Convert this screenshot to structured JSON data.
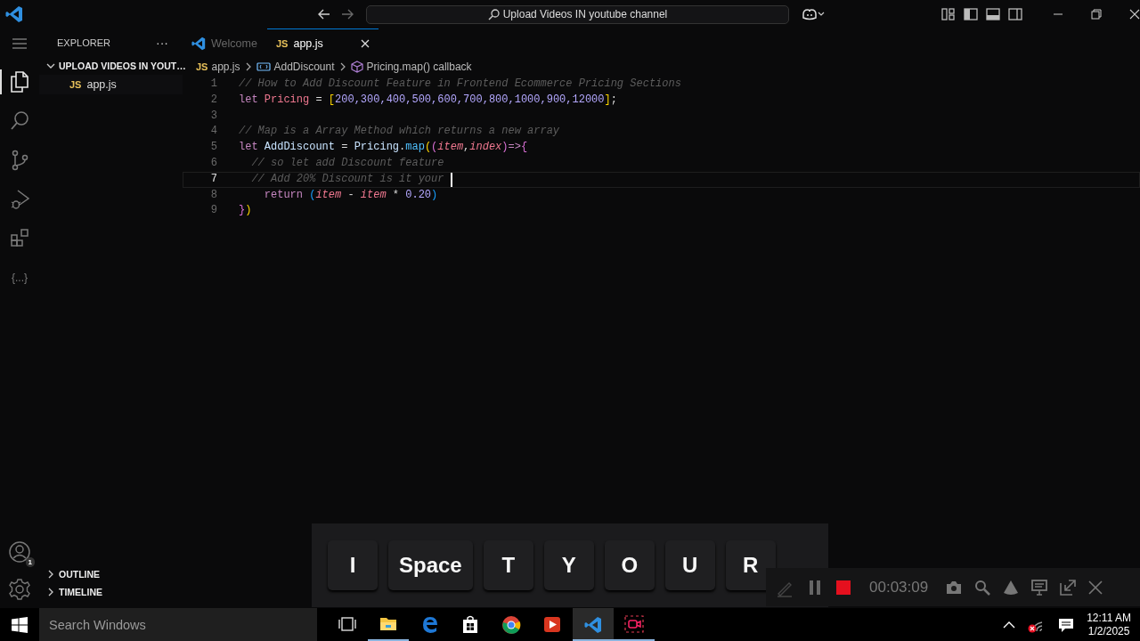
{
  "title_bar": {
    "search_text": "Upload Videos IN youtube channel"
  },
  "activity_bar": {
    "items": [
      {
        "kind": "files",
        "selected": true
      },
      {
        "kind": "search",
        "selected": false
      },
      {
        "kind": "source-control",
        "selected": false
      },
      {
        "kind": "run-debug",
        "selected": false
      },
      {
        "kind": "extensions",
        "selected": false
      },
      {
        "kind": "text",
        "label": "{...}",
        "selected": false
      }
    ],
    "account_badge": "1"
  },
  "sidebar": {
    "title": "EXPLORER",
    "more": "···",
    "folder": {
      "name": "UPLOAD VIDEOS IN YOUT…",
      "expanded": true,
      "files": [
        {
          "badge": "JS",
          "name": "app.js"
        }
      ]
    },
    "sections": [
      {
        "name": "OUTLINE",
        "expanded": false
      },
      {
        "name": "TIMELINE",
        "expanded": false
      }
    ]
  },
  "tabs": [
    {
      "kind": "welcome",
      "label": "Welcome",
      "selected": false
    },
    {
      "kind": "js",
      "badge": "JS",
      "label": "app.js",
      "selected": true
    }
  ],
  "breadcrumb": [
    {
      "kind": "js",
      "badge": "JS",
      "label": "app.js"
    },
    {
      "kind": "variable",
      "label": "AddDiscount"
    },
    {
      "kind": "method",
      "label": "Pricing.map() callback"
    }
  ],
  "code_lines": [
    {
      "number": "1",
      "selected": false,
      "tokens": [
        {
          "kind": "comment",
          "text": "// How to Add Discount Feature in Frontend Ecommerce Pricing Sections"
        }
      ]
    },
    {
      "number": "2",
      "selected": false,
      "tokens": [
        {
          "kind": "kw",
          "text": "let "
        },
        {
          "kind": "var",
          "text": "Pricing"
        },
        {
          "kind": "plain",
          "text": " = "
        },
        {
          "kind": "bracket",
          "text": "["
        },
        {
          "kind": "num",
          "text": "200,300,400,500,600,700,800,1000,900,12000"
        },
        {
          "kind": "bracket",
          "text": "]"
        },
        {
          "kind": "plain",
          "text": ";"
        }
      ]
    },
    {
      "number": "3",
      "selected": false
    },
    {
      "number": "4",
      "selected": false,
      "tokens": [
        {
          "kind": "comment",
          "text": "// Map is a Array Method which returns a new array"
        }
      ]
    },
    {
      "number": "5",
      "selected": false,
      "tokens": [
        {
          "kind": "kw",
          "text": "let "
        },
        {
          "kind": "name",
          "text": "AddDiscount"
        },
        {
          "kind": "plain",
          "text": " = "
        },
        {
          "kind": "name",
          "text": "Pricing"
        },
        {
          "kind": "plain",
          "text": "."
        },
        {
          "kind": "fn",
          "text": "map"
        },
        {
          "kind": "bracket",
          "text": "("
        },
        {
          "kind": "bracket2",
          "text": "("
        },
        {
          "kind": "param",
          "text": "item"
        },
        {
          "kind": "plain",
          "text": ","
        },
        {
          "kind": "param",
          "text": "index"
        },
        {
          "kind": "bracket2",
          "text": ")"
        },
        {
          "kind": "kw",
          "text": "=>"
        },
        {
          "kind": "bracket2",
          "text": "{"
        }
      ]
    },
    {
      "number": "6",
      "selected": false,
      "tokens": [
        {
          "kind": "comment",
          "text": "  // so let add Discount feature"
        }
      ]
    },
    {
      "number": "7",
      "selected": true,
      "cursor": true,
      "tokens": [
        {
          "kind": "comment",
          "text": "  // Add 20% Discount is it your "
        }
      ]
    },
    {
      "number": "8",
      "selected": false,
      "tokens": [
        {
          "kind": "kw",
          "text": "    return "
        },
        {
          "kind": "bracket3",
          "text": "("
        },
        {
          "kind": "param",
          "text": "item"
        },
        {
          "kind": "plain",
          "text": " - "
        },
        {
          "kind": "param",
          "text": "item"
        },
        {
          "kind": "plain",
          "text": " * "
        },
        {
          "kind": "num",
          "text": "0.20"
        },
        {
          "kind": "bracket3",
          "text": ")"
        }
      ]
    },
    {
      "number": "9",
      "selected": false,
      "tokens": [
        {
          "kind": "bracket2",
          "text": "}"
        },
        {
          "kind": "bracket",
          "text": ")"
        }
      ]
    }
  ],
  "keystrokes": [
    "I",
    "Space",
    "T",
    "Y",
    "O",
    "U",
    "R"
  ],
  "recorder": {
    "time": "00:03:09"
  },
  "taskbar": {
    "search_placeholder": "Search Windows",
    "apps": [
      {
        "kind": "task-view",
        "selected": false,
        "running": false
      },
      {
        "kind": "folder",
        "selected": false,
        "running": true
      },
      {
        "kind": "edge",
        "selected": false,
        "running": false
      },
      {
        "kind": "store",
        "selected": false,
        "running": false
      },
      {
        "kind": "chrome",
        "selected": false,
        "running": false
      },
      {
        "kind": "player",
        "selected": false,
        "running": false
      },
      {
        "kind": "vscode",
        "selected": true,
        "running": true
      },
      {
        "kind": "recorder",
        "selected": false,
        "running": true
      }
    ],
    "time": "12:11 AM",
    "date": "1/2/2025"
  }
}
